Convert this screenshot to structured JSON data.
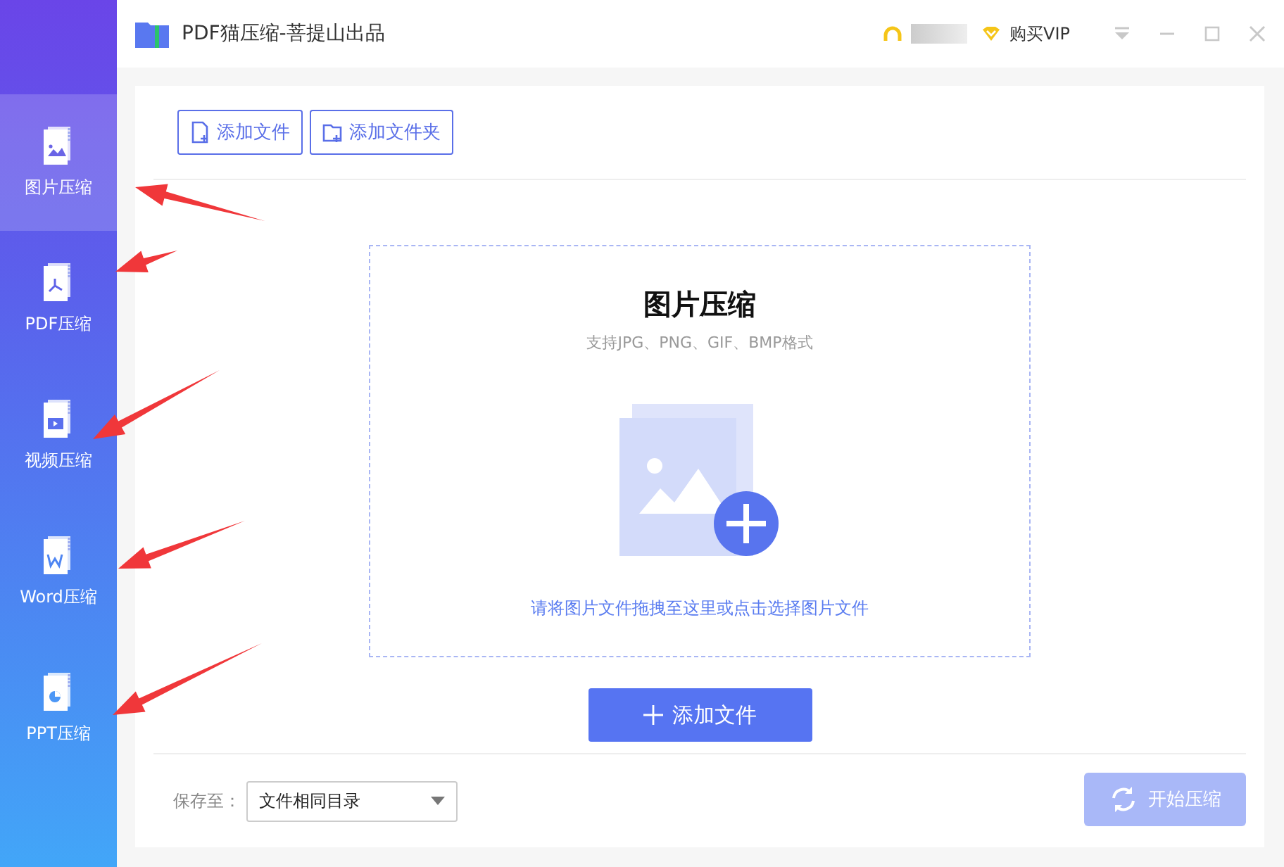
{
  "window": {
    "title": "PDF猫压缩-菩提山出品",
    "vip_label": "购买VIP"
  },
  "sidebar": {
    "items": [
      {
        "label": "图片压缩",
        "kind": "image",
        "selected": true
      },
      {
        "label": "PDF压缩",
        "kind": "pdf",
        "selected": false
      },
      {
        "label": "视频压缩",
        "kind": "video",
        "selected": false
      },
      {
        "label": "Word压缩",
        "kind": "word",
        "selected": false
      },
      {
        "label": "PPT压缩",
        "kind": "ppt",
        "selected": false
      }
    ]
  },
  "toolbar": {
    "buttons": [
      {
        "label": "添加文件",
        "kind": "file"
      },
      {
        "label": "添加文件夹",
        "kind": "folder"
      }
    ]
  },
  "drop_zone": {
    "title": "图片压缩",
    "formats": "支持JPG、PNG、GIF、BMP格式",
    "hint": "请将图片文件拖拽至这里或点击选择图片文件"
  },
  "add_button": {
    "label": "添加文件"
  },
  "footer": {
    "save_label": "保存至：",
    "save_value": "文件相同目录",
    "start_button": {
      "label": "开始压缩",
      "disabled": true
    }
  }
}
